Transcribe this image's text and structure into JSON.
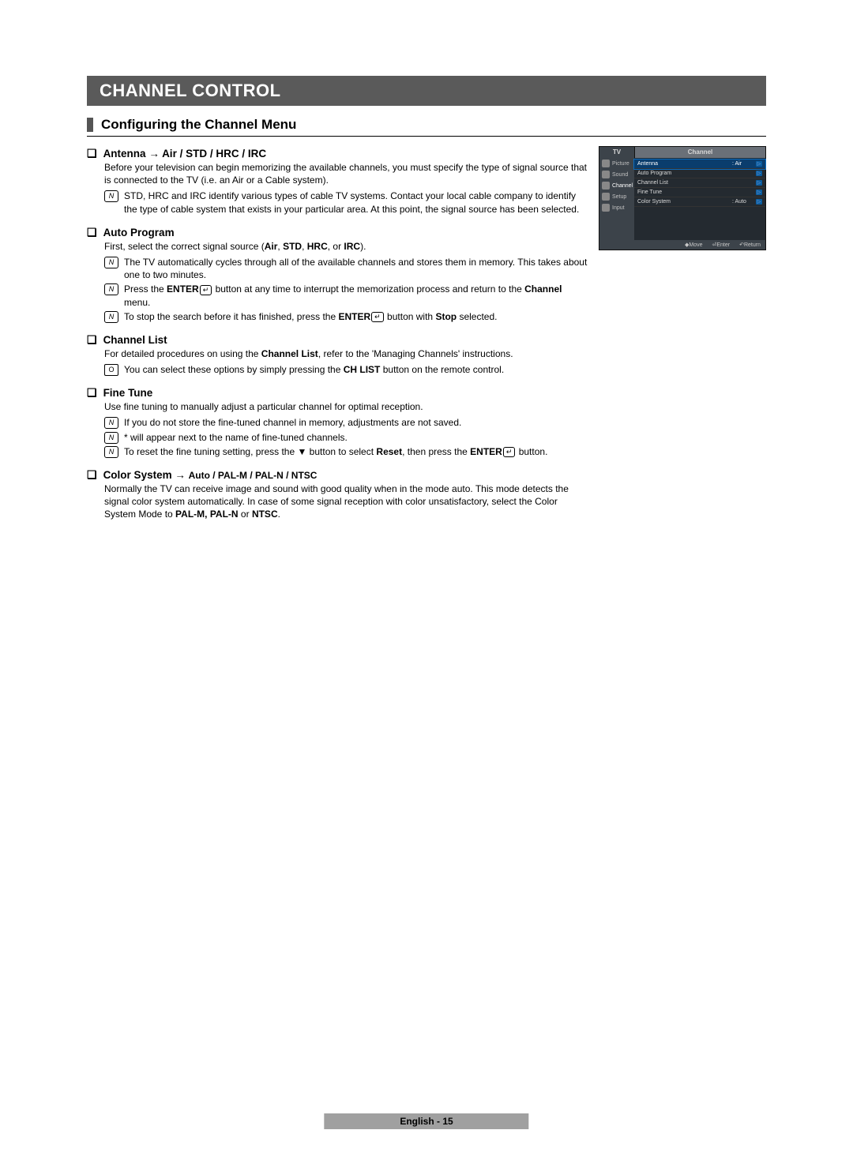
{
  "title": "CHANNEL CONTROL",
  "subheading": "Configuring the Channel Menu",
  "sections": {
    "antenna": {
      "title": "Antenna → Air / STD / HRC / IRC",
      "body": "Before your television can begin memorizing the available channels, you must specify the type of signal source that is connected to the TV (i.e. an Air or a Cable system).",
      "note1": "STD, HRC and IRC identify various types of cable TV systems. Contact your local cable company to identify the type of cable system that exists in your particular area. At this point, the signal source has been selected."
    },
    "autoprogram": {
      "title": "Auto Program",
      "body_pre": "First, select the correct signal source (",
      "body_b1": "Air",
      "body_c1": ", ",
      "body_b2": "STD",
      "body_c2": ", ",
      "body_b3": "HRC",
      "body_c3": ", or ",
      "body_b4": "IRC",
      "body_post": ").",
      "note1": "The TV automatically cycles through all of the available channels and stores them in memory. This takes about one to two minutes.",
      "note2_pre": "Press the ",
      "note2_b1": "ENTER",
      "note2_mid": " button at any time to interrupt the memorization process and return to the ",
      "note2_b2": "Channel",
      "note2_post": " menu.",
      "note3_pre": "To stop the search before it has finished, press the ",
      "note3_b1": "ENTER",
      "note3_mid": " button with ",
      "note3_b2": "Stop",
      "note3_post": " selected."
    },
    "channellist": {
      "title": "Channel List",
      "body_pre": "For detailed procedures on using the ",
      "body_b": "Channel List",
      "body_post": ", refer to the 'Managing Channels' instructions.",
      "note1_pre": "You can select these options by simply pressing the ",
      "note1_b": "CH LIST",
      "note1_post": " button on the remote control."
    },
    "finetune": {
      "title": "Fine Tune",
      "body": "Use fine tuning to manually adjust a particular channel for optimal reception.",
      "note1": "If you do not store the fine-tuned channel in memory, adjustments are not saved.",
      "note2": "* will appear next to the name of fine-tuned channels.",
      "note3_pre": "To reset the fine tuning setting, press the ▼ button to select ",
      "note3_b1": "Reset",
      "note3_mid": ", then press the ",
      "note3_b2": "ENTER",
      "note3_post": " button."
    },
    "colorsystem": {
      "title_main": "Color System → ",
      "title_sub": "Auto / PAL-M / PAL-N / NTSC",
      "body_pre": "Normally the TV can receive image and sound with good quality when in the mode auto. This mode detects the signal color system automatically. In case of some signal reception with color unsatisfactory, select the Color System Mode to ",
      "body_b": "PAL-M, PAL-N",
      "body_mid": " or ",
      "body_b2": "NTSC",
      "body_post": "."
    }
  },
  "osd": {
    "tv": "TV",
    "tab": "Channel",
    "side": [
      "Picture",
      "Sound",
      "Channel",
      "Setup",
      "Input"
    ],
    "rows": [
      {
        "lbl": "Antenna",
        "val": ": Air"
      },
      {
        "lbl": "Auto Program",
        "val": ""
      },
      {
        "lbl": "Channel List",
        "val": ""
      },
      {
        "lbl": "Fine Tune",
        "val": ""
      },
      {
        "lbl": "Color System",
        "val": ": Auto"
      }
    ],
    "footer": {
      "move": "Move",
      "enter": "Enter",
      "return": "Return"
    }
  },
  "footer": "English - 15",
  "icons": {
    "note": "N",
    "remote": "O",
    "enter": "↵",
    "updown": "◆",
    "enterglyph": "⏎",
    "returnglyph": "↶"
  }
}
